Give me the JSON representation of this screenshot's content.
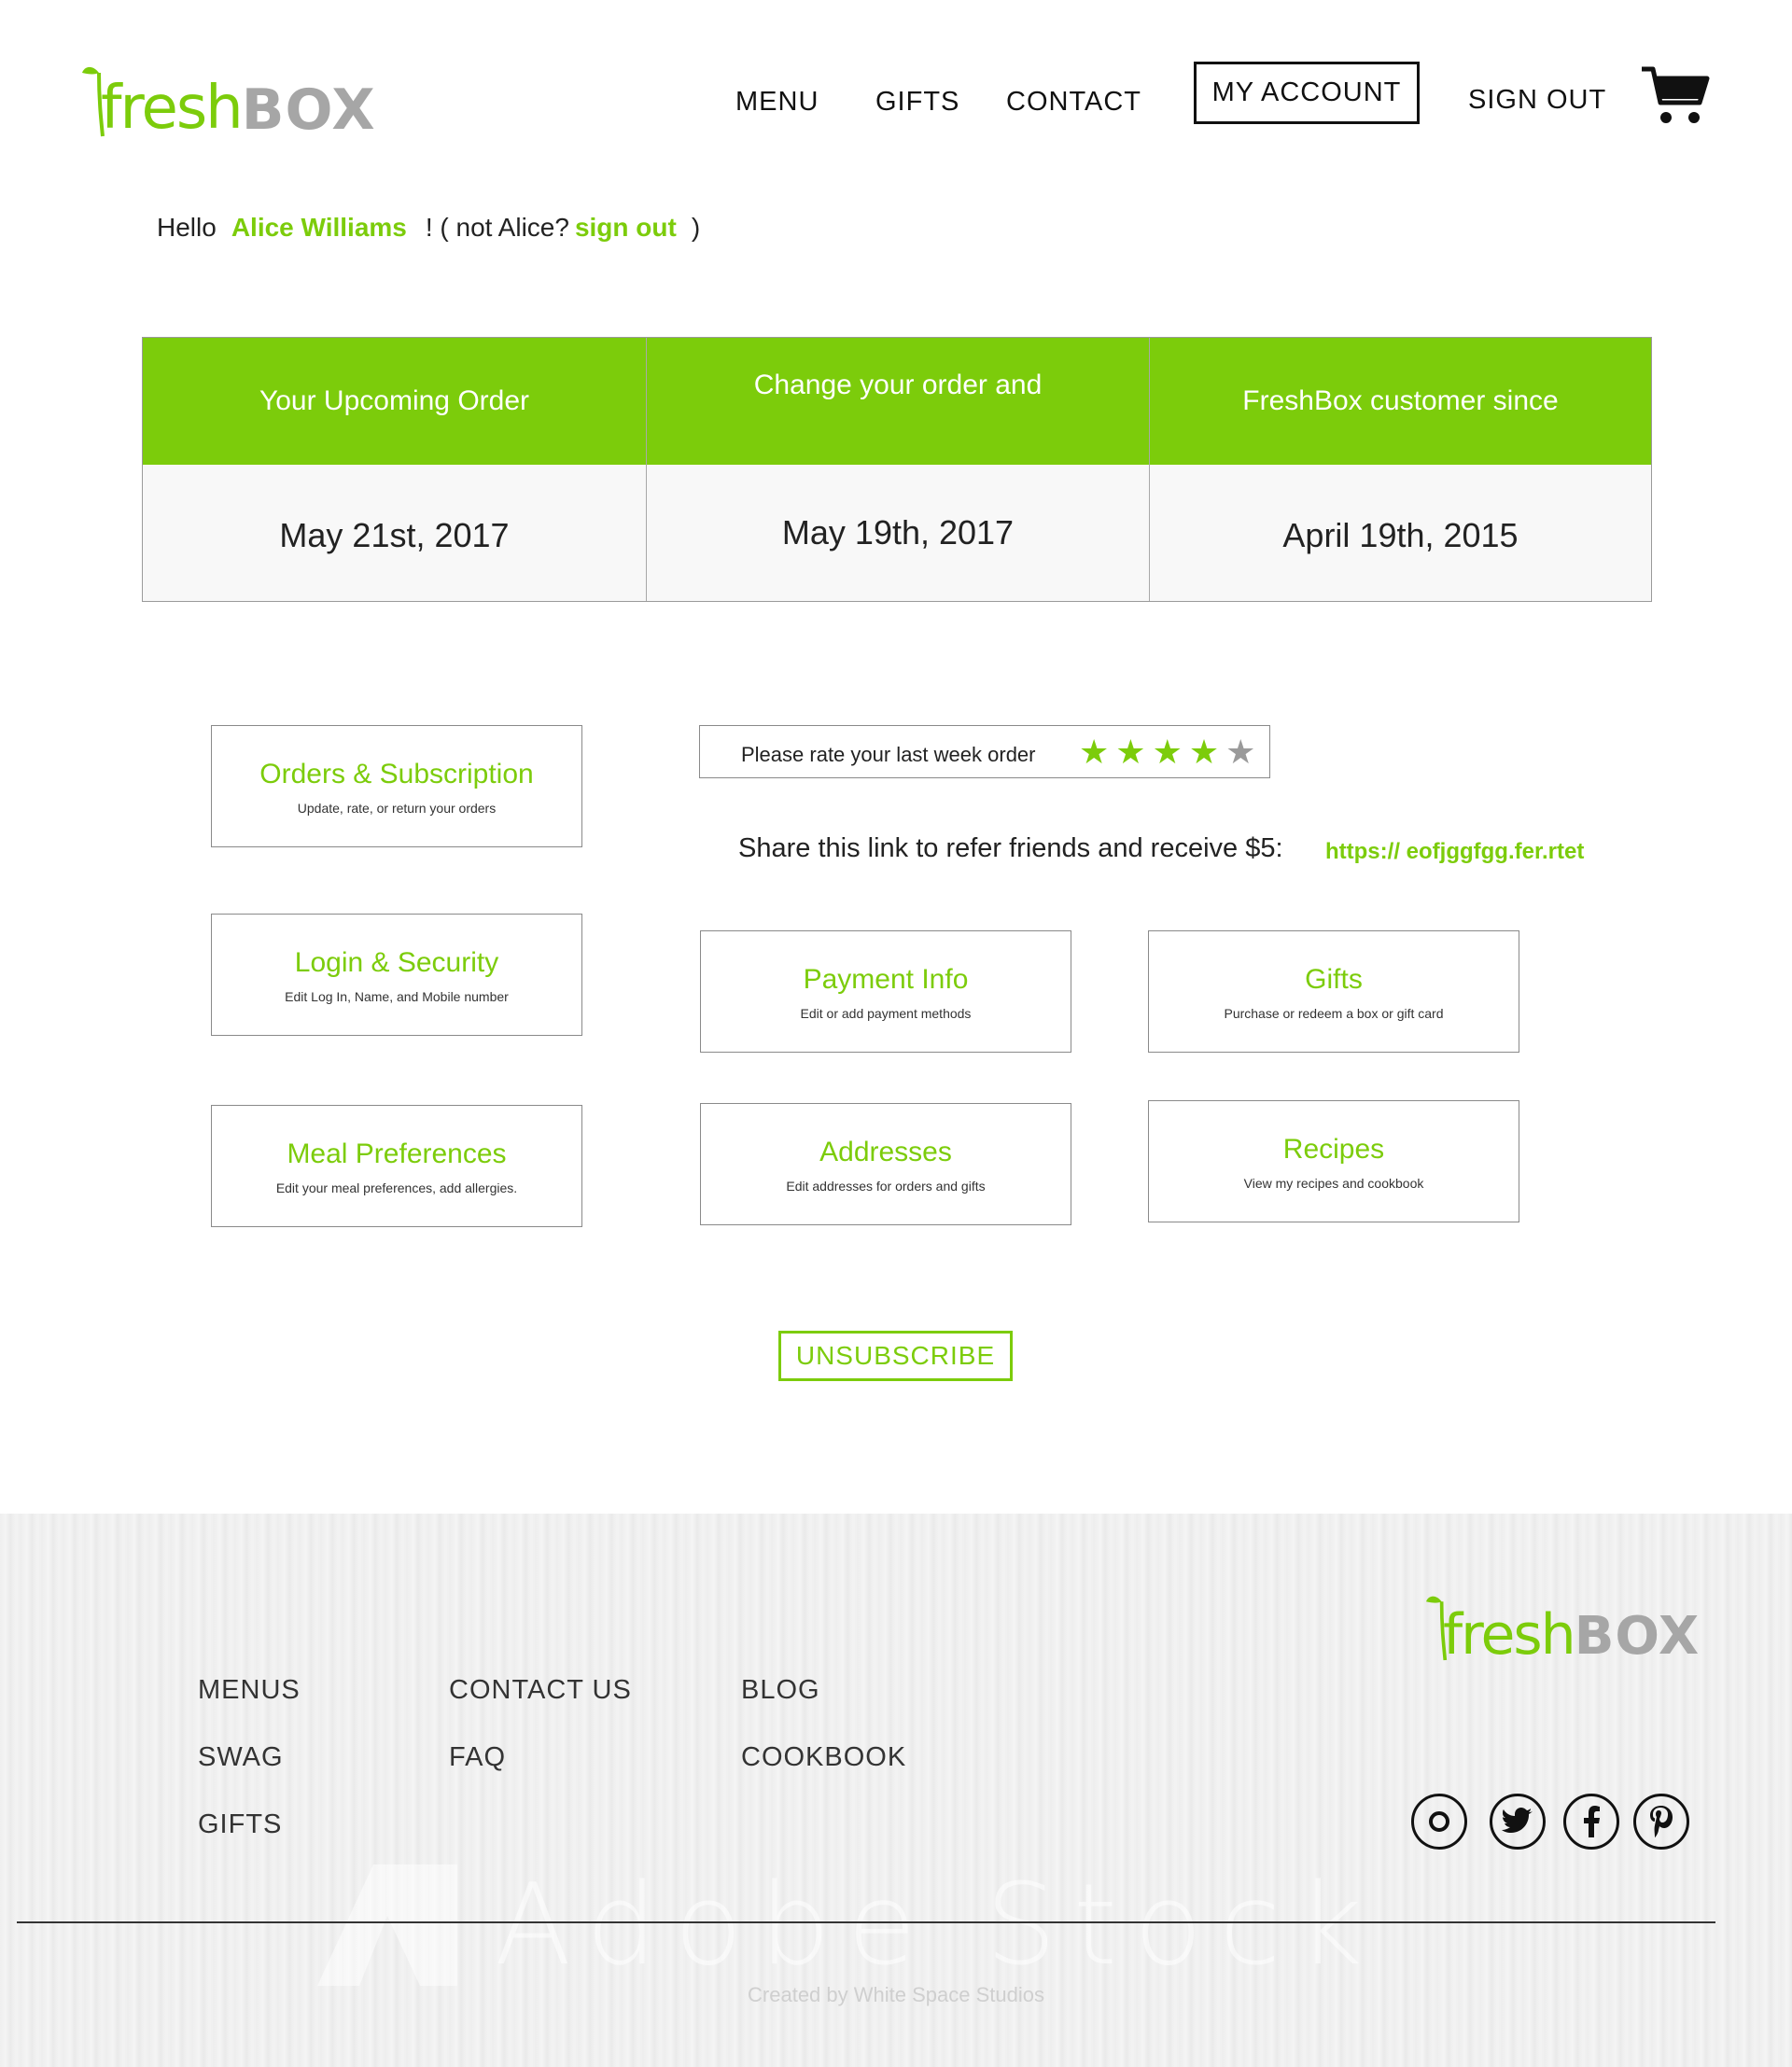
{
  "brand": {
    "fresh": "fresh",
    "box": "BOX"
  },
  "nav": {
    "menu": "MENU",
    "gifts": "GIFTS",
    "contact": "CONTACT",
    "my_account": "MY ACCOUNT",
    "sign_out": "SIGN OUT"
  },
  "greeting": {
    "hello": "Hello",
    "name": "Alice Williams",
    "not_prefix": "! ( not Alice?",
    "sign_out_link": "sign out",
    "close": ")"
  },
  "summary": [
    {
      "header": "Your Upcoming Order",
      "value": "May 21st, 2017"
    },
    {
      "header": "Change your order and",
      "value": "May 19th, 2017"
    },
    {
      "header": "FreshBox customer since",
      "value": "April 19th, 2015"
    }
  ],
  "rating": {
    "label": "Please rate your last week order",
    "rating": 4,
    "max": 5,
    "filled_color": "#7ccc0b",
    "empty_color": "#9a9a9a"
  },
  "referral": {
    "text": "Share this link to refer friends and receive $5:",
    "link": "https:// eofjggfgg.fer.rtet"
  },
  "cards": {
    "orders": {
      "title": "Orders & Subscription",
      "subtitle": "Update, rate, or return your orders"
    },
    "login": {
      "title": "Login & Security",
      "subtitle": "Edit Log In, Name, and Mobile number"
    },
    "payment": {
      "title": "Payment Info",
      "subtitle": "Edit or add payment methods"
    },
    "gifts": {
      "title": "Gifts",
      "subtitle": "Purchase or redeem a box or gift card"
    },
    "meal": {
      "title": "Meal Preferences",
      "subtitle": "Edit your meal preferences, add allergies."
    },
    "addresses": {
      "title": "Addresses",
      "subtitle": "Edit addresses for orders and gifts"
    },
    "recipes": {
      "title": "Recipes",
      "subtitle": "View my recipes and cookbook"
    }
  },
  "unsubscribe": "UNSUBSCRIBE",
  "footer": {
    "links": {
      "menus": "MENUS",
      "swag": "SWAG",
      "gifts": "GIFTS",
      "contact_us": "CONTACT US",
      "faq": "FAQ",
      "blog": "BLOG",
      "cookbook": "COOKBOOK"
    },
    "social": [
      "instagram-icon",
      "twitter-icon",
      "facebook-icon",
      "pinterest-icon"
    ],
    "credit": "Created by White Space Studios",
    "watermark": "Adobe Stock"
  },
  "colors": {
    "accent": "#7ccc0b",
    "box_gray": "#a6a6a6"
  }
}
